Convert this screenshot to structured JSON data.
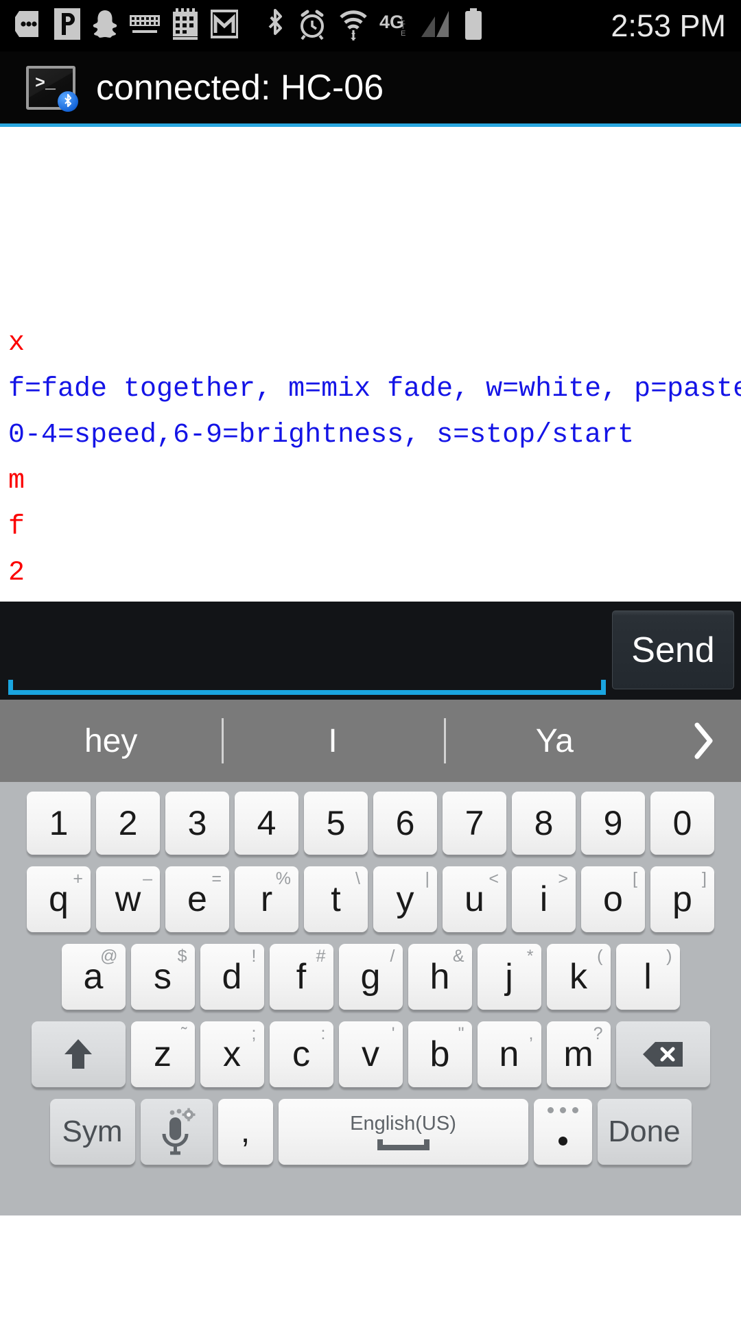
{
  "status_bar": {
    "icons": [
      "messages-icon",
      "pandora-icon",
      "snapchat-icon",
      "keyboard-icon",
      "calendar-icon",
      "gmail-icon",
      "bluetooth-icon",
      "alarm-icon",
      "wifi-icon",
      "network-4glte-icon",
      "signal-bars-icon",
      "battery-icon"
    ],
    "network_label": "4G",
    "network_sub": "LTE",
    "clock": "2:53 PM"
  },
  "app_header": {
    "icon": "bluetooth-terminal-icon",
    "prompt_glyph": ">_",
    "title": "connected: HC-06",
    "accent_color": "#2aa7df"
  },
  "terminal": {
    "text_color_sent": "#fb0000",
    "text_color_received": "#1414e6",
    "lines": [
      {
        "text": "x",
        "type": "sent"
      },
      {
        "text": "f=fade together, m=mix fade, w=white, p=pastel",
        "type": "received"
      },
      {
        "text": "0-4=speed,6-9=brightness, s=stop/start",
        "type": "received"
      },
      {
        "text": "m",
        "type": "sent"
      },
      {
        "text": "f",
        "type": "sent"
      },
      {
        "text": "2",
        "type": "sent"
      }
    ]
  },
  "input_bar": {
    "value": "",
    "placeholder": "",
    "send_label": "Send",
    "underline_color": "#1aa5e0"
  },
  "keyboard": {
    "suggestions": [
      "hey",
      "I",
      "Ya"
    ],
    "expand_icon": "chevron-right-icon",
    "row_numbers": [
      "1",
      "2",
      "3",
      "4",
      "5",
      "6",
      "7",
      "8",
      "9",
      "0"
    ],
    "row_qwerty": [
      {
        "key": "q",
        "sub": "+"
      },
      {
        "key": "w",
        "sub": "–"
      },
      {
        "key": "e",
        "sub": "="
      },
      {
        "key": "r",
        "sub": "%"
      },
      {
        "key": "t",
        "sub": "\\"
      },
      {
        "key": "y",
        "sub": "|"
      },
      {
        "key": "u",
        "sub": "<"
      },
      {
        "key": "i",
        "sub": ">"
      },
      {
        "key": "o",
        "sub": "["
      },
      {
        "key": "p",
        "sub": "]"
      }
    ],
    "row_asdf": [
      {
        "key": "a",
        "sub": "@"
      },
      {
        "key": "s",
        "sub": "$"
      },
      {
        "key": "d",
        "sub": "!"
      },
      {
        "key": "f",
        "sub": "#"
      },
      {
        "key": "g",
        "sub": "/"
      },
      {
        "key": "h",
        "sub": "&"
      },
      {
        "key": "j",
        "sub": "*"
      },
      {
        "key": "k",
        "sub": "("
      },
      {
        "key": "l",
        "sub": ")"
      }
    ],
    "row_zxcv": [
      {
        "key": "z",
        "sub": "˜"
      },
      {
        "key": "x",
        "sub": ";"
      },
      {
        "key": "c",
        "sub": ":"
      },
      {
        "key": "v",
        "sub": "'"
      },
      {
        "key": "b",
        "sub": "\""
      },
      {
        "key": "n",
        "sub": ","
      },
      {
        "key": "m",
        "sub": "?"
      }
    ],
    "shift_icon": "shift-up-arrow-icon",
    "backspace_icon": "backspace-icon",
    "sym_label": "Sym",
    "mic_icon": "microphone-settings-icon",
    "comma_label": ",",
    "space_label": "English(US)",
    "space_icon": "spacebar-icon",
    "period_label": ".",
    "done_label": "Done"
  }
}
